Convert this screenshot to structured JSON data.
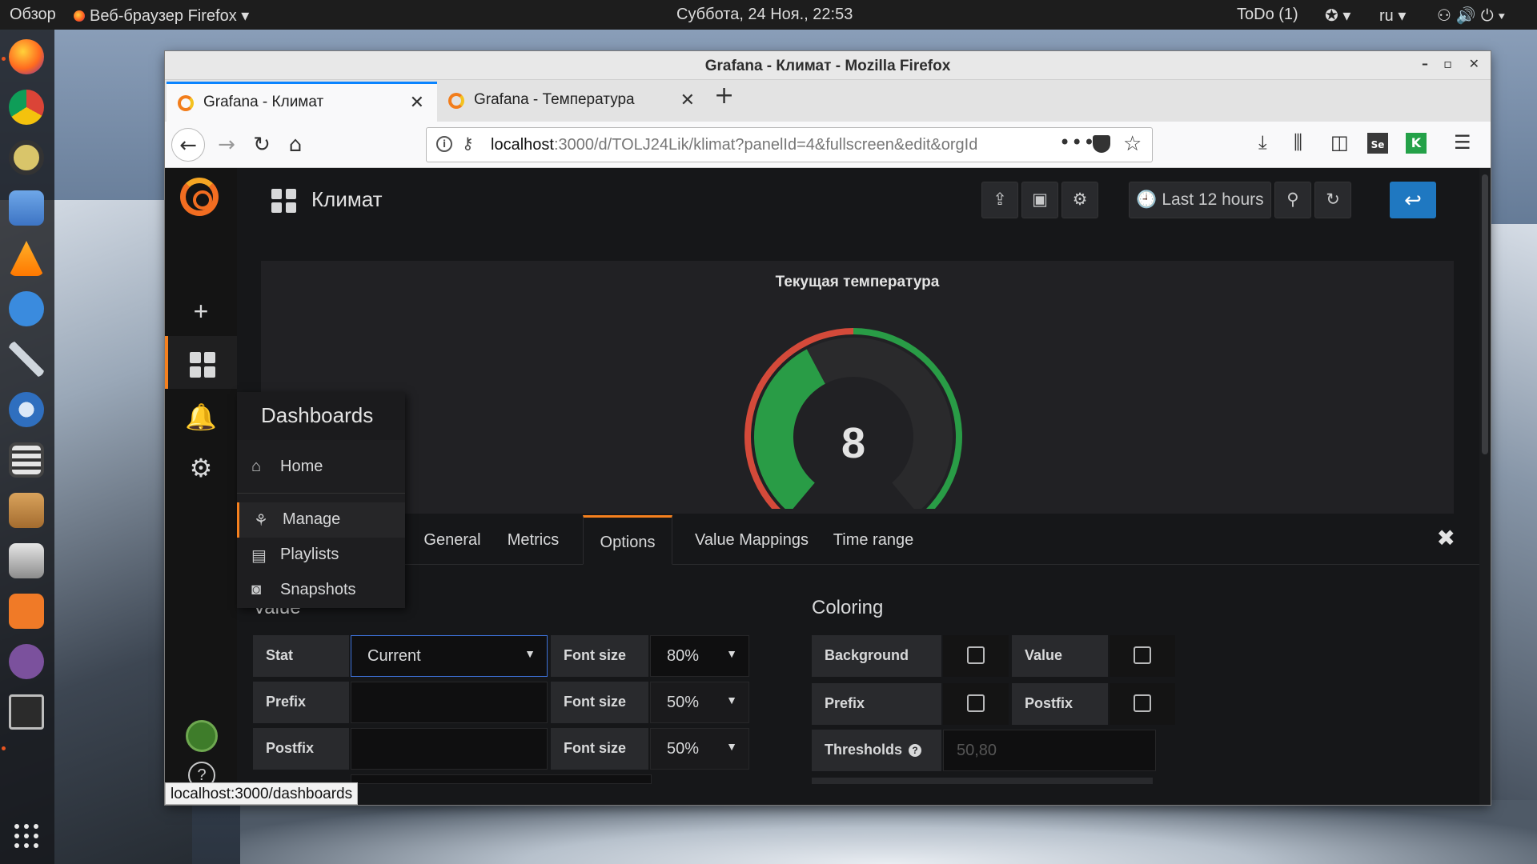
{
  "desktop": {
    "overview": "Обзор",
    "active_app": "Веб-браузер Firefox",
    "clock": "Суббота, 24 Ноя., 22:53",
    "todo": "ToDo (1)",
    "lang": "ru"
  },
  "dock": {
    "items": [
      "firefox-icon",
      "chrome-icon",
      "rhythmbox-icon",
      "files-icon",
      "vlc-icon",
      "simplenote-icon",
      "tools-icon",
      "thunderbird-icon",
      "calculator-icon",
      "archive-icon",
      "installer-icon",
      "software-center-icon",
      "viber-icon",
      "terminal-icon"
    ]
  },
  "browser": {
    "window_title": "Grafana - Климат - Mozilla Firefox",
    "tabs": [
      {
        "label": "Grafana - Климат",
        "active": true
      },
      {
        "label": "Grafana - Температура",
        "active": false
      }
    ],
    "url_host": "localhost",
    "url_rest": ":3000/d/TOLJ24Lik/klimat?panelId=4&fullscreen&edit&orgId",
    "status_url": "localhost:3000/dashboards"
  },
  "grafana": {
    "dashboard_title": "Климат",
    "time_range_label": "Last 12 hours",
    "menu": {
      "header": "Dashboards",
      "items": [
        {
          "label": "Home",
          "icon": "home-icon"
        },
        {
          "label": "Manage",
          "icon": "sitemap-icon"
        },
        {
          "label": "Playlists",
          "icon": "playlist-icon"
        },
        {
          "label": "Snapshots",
          "icon": "snapshot-icon"
        }
      ]
    },
    "panel": {
      "title": "Текущая температура",
      "value": "8",
      "gauge_fraction": 0.4,
      "thresholds": [
        50,
        80
      ],
      "colors": {
        "ok": "#299c46",
        "warn": "#e8a630",
        "bad": "#d44a3a",
        "track": "#2a2a2c"
      }
    },
    "editor": {
      "panel_type": "Singlestat",
      "tabs": [
        "General",
        "Metrics",
        "Options",
        "Value Mappings",
        "Time range"
      ],
      "active_tab": "Options",
      "value_section": "Value",
      "stat_label": "Stat",
      "stat_value": "Current",
      "prefix_label": "Prefix",
      "postfix_label": "Postfix",
      "font_size_label": "Font size",
      "font_size_stat": "80%",
      "font_size_prefix": "50%",
      "font_size_postfix": "50%",
      "coloring_section": "Coloring",
      "background_label": "Background",
      "value_label": "Value",
      "color_prefix_label": "Prefix",
      "color_postfix_label": "Postfix",
      "thresholds_label": "Thresholds",
      "thresholds_placeholder": "50,80"
    }
  }
}
